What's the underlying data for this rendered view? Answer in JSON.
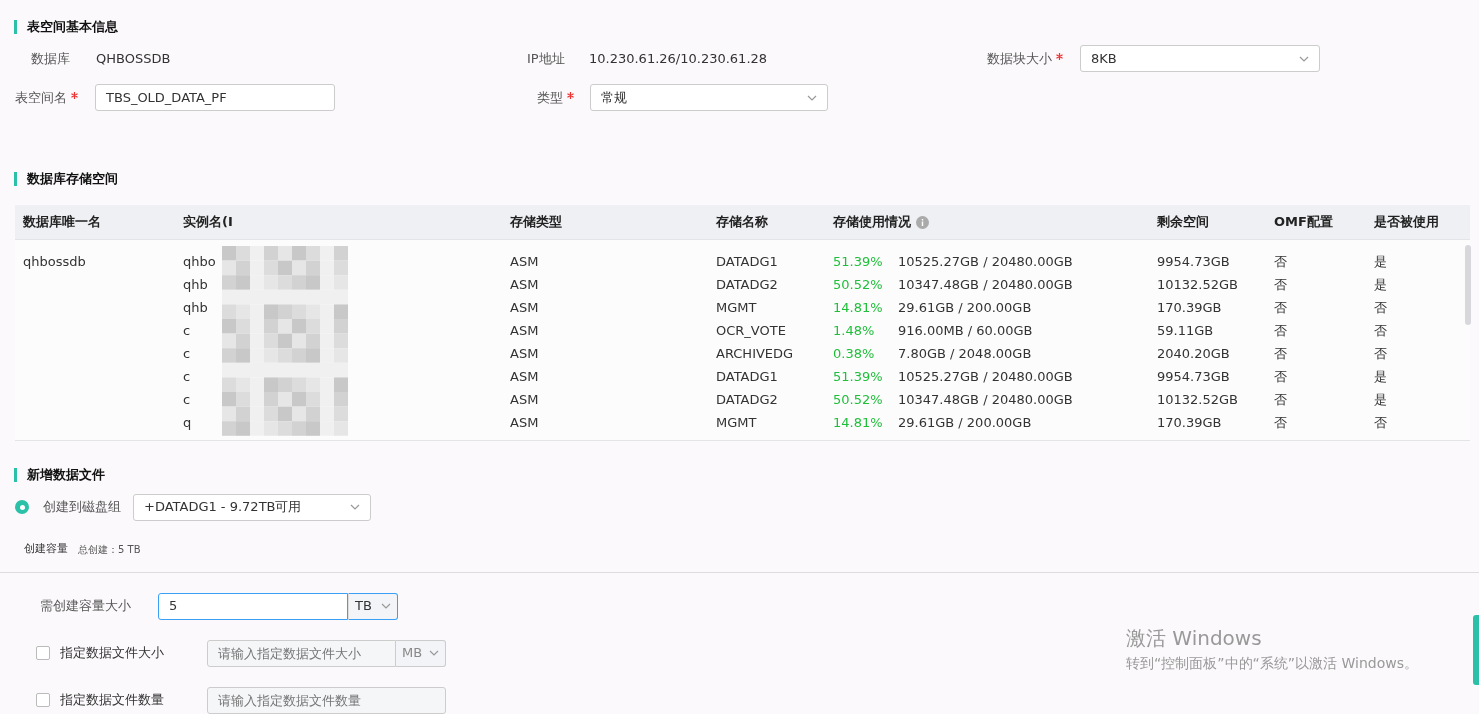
{
  "basic_info": {
    "title": "表空间基本信息",
    "row1": [
      {
        "label": "数据库",
        "value": "QHBOSSDB",
        "kind": "text",
        "required": false
      },
      {
        "label": "IP地址",
        "value": "10.230.61.26/10.230.61.28",
        "kind": "text",
        "required": false
      },
      {
        "label": "数据块大小",
        "value": "8KB",
        "kind": "select",
        "required": true
      }
    ],
    "row2": [
      {
        "label": "表空间名",
        "value": "TBS_OLD_DATA_PF",
        "kind": "input",
        "required": true
      },
      {
        "label": "类型",
        "value": "常规",
        "kind": "select",
        "required": true
      }
    ]
  },
  "storage": {
    "title": "数据库存储空间",
    "columns": [
      "数据库唯一名",
      "实例名(I",
      "存储类型",
      "存储名称",
      "存储使用情况",
      "剩余空间",
      "OMF配置",
      "是否被使用"
    ],
    "rows": [
      {
        "db": "qhbossdb",
        "instance": "qhbo",
        "type": "ASM",
        "name": "DATADG1",
        "pct": "51.39%",
        "usage": "10525.27GB / 20480.00GB",
        "free": "9954.73GB",
        "omf": "否",
        "used": "是"
      },
      {
        "instance": "qhb",
        "type": "ASM",
        "name": "DATADG2",
        "pct": "50.52%",
        "usage": "10347.48GB / 20480.00GB",
        "free": "10132.52GB",
        "omf": "否",
        "used": "是"
      },
      {
        "instance": "qhb",
        "type": "ASM",
        "name": "MGMT",
        "pct": "14.81%",
        "usage": "29.61GB / 200.00GB",
        "free": "170.39GB",
        "omf": "否",
        "used": "否"
      },
      {
        "instance": "c",
        "type": "ASM",
        "name": "OCR_VOTE",
        "pct": "1.48%",
        "usage": "916.00MB / 60.00GB",
        "free": "59.11GB",
        "omf": "否",
        "used": "否"
      },
      {
        "instance": "c",
        "type": "ASM",
        "name": "ARCHIVEDG",
        "pct": "0.38%",
        "usage": "7.80GB / 2048.00GB",
        "free": "2040.20GB",
        "omf": "否",
        "used": "否"
      },
      {
        "instance": "c",
        "type": "ASM",
        "name": "DATADG1",
        "pct": "51.39%",
        "usage": "10525.27GB / 20480.00GB",
        "free": "9954.73GB",
        "omf": "否",
        "used": "是"
      },
      {
        "instance": "c",
        "type": "ASM",
        "name": "DATADG2",
        "pct": "50.52%",
        "usage": "10347.48GB / 20480.00GB",
        "free": "10132.52GB",
        "omf": "否",
        "used": "是"
      },
      {
        "instance": "q",
        "type": "ASM",
        "name": "MGMT",
        "pct": "14.81%",
        "usage": "29.61GB / 200.00GB",
        "free": "170.39GB",
        "omf": "否",
        "used": "否"
      }
    ]
  },
  "new_datafile": {
    "title": "新增数据文件",
    "target": {
      "label": "创建到磁盘组",
      "selected": true,
      "value": "+DATADG1 - 9.72TB可用"
    },
    "capacity": {
      "label": "创建容量",
      "summary": "总创建：5 TB"
    },
    "size": {
      "label": "需创建容量大小",
      "value": "5",
      "unit": "TB"
    },
    "options": [
      {
        "label": "指定数据文件大小",
        "checked": false,
        "placeholder": "请输入指定数据文件大小",
        "unit": "MB"
      },
      {
        "label": "指定数据文件数量",
        "checked": false,
        "placeholder": "请输入指定数据文件数量"
      }
    ]
  },
  "activation": {
    "title": "激活 Windows",
    "text": "转到“控制面板”中的“系统”以激活 Windows。"
  }
}
